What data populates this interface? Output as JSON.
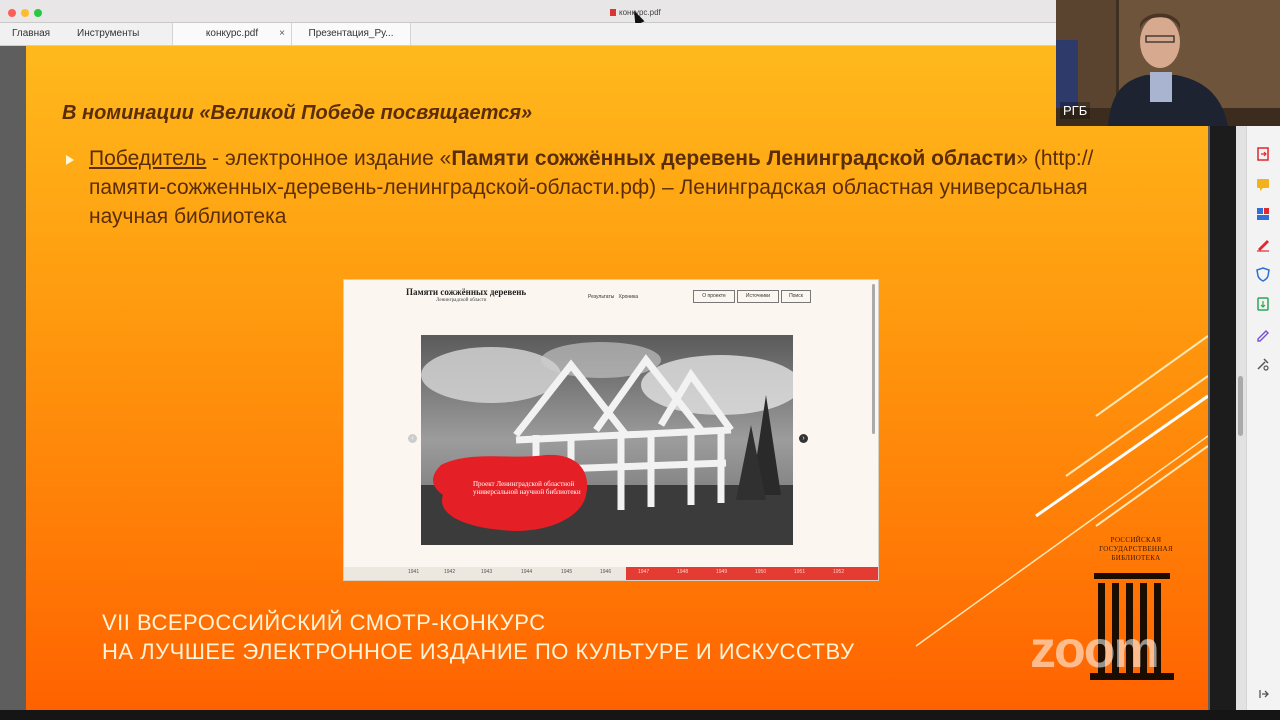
{
  "window": {
    "title": "конкурс.pdf",
    "traffic_lights": [
      "#fc5f57",
      "#fdbc2e",
      "#29c840"
    ]
  },
  "tabs": {
    "home": "Главная",
    "tools": "Инструменты",
    "doc1": "конкурс.pdf",
    "doc1_close": "×",
    "doc2": "Презентация_Ру..."
  },
  "slide": {
    "heading": "В номинации «Великой Победе посвящается»",
    "bullet": {
      "winner_label": "Победитель",
      "text_before_title": " - электронное издание «",
      "title": "Памяти сожжённых деревень Ленинградской области",
      "text_after_title": "» (http://памяти-сожженных-деревень-ленинградской-области.рф) – Ленинградская областная универсальная научная библиотека"
    },
    "footer_line1": "VII ВСЕРОССИЙСКИЙ СМОТР-КОНКУРС",
    "footer_line2": "НА ЛУЧШЕЕ ЭЛЕКТРОННОЕ ИЗДАНИЕ ПО КУЛЬТУРЕ И ИСКУССТВУ",
    "colors": {
      "gradient_top": "#ffb91c",
      "gradient_bottom": "#ff6200",
      "heading": "#5b2d06",
      "footer": "#fff3d8"
    }
  },
  "website_screenshot": {
    "title": "Памяти сожжённых деревень",
    "subtitle": "Ленинградской области",
    "nav_1": "Результаты",
    "nav_2": "Хроника",
    "btn_1": "О проекте",
    "btn_2": "Источники",
    "btn_3": "Поиск",
    "caption": "Проект Ленинградской областной универсальной научной библиотеки",
    "timeline": [
      "1941",
      "1942",
      "1943",
      "1944",
      "1945",
      "1946",
      "1947",
      "1948",
      "1949",
      "1950",
      "1951",
      "1952"
    ],
    "accent": "#e43b32"
  },
  "webcam": {
    "label": "РГБ"
  },
  "logo": {
    "text": "РОССИЙСКАЯ ГОСУДАРСТВЕННАЯ БИБЛИОТЕКА"
  },
  "watermark": "zoom"
}
